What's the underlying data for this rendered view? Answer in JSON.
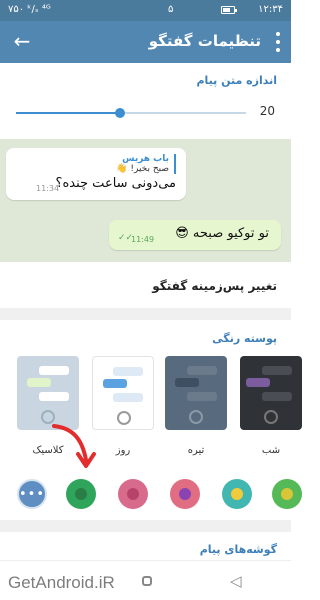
{
  "status_bar": {
    "time": "۱۲:۳۴",
    "left_text": "۷۵۰ ᵏ/ₛ ⁴ᴳ",
    "mid_text": "۵"
  },
  "app_bar": {
    "title": "تنظیمات گفتگو",
    "back_icon": "arrow-back-icon",
    "menu_icon": "more-vert-icon"
  },
  "text_size": {
    "label": "اندازه متن پیام",
    "value": "20",
    "level": 0.45
  },
  "preview": {
    "incoming": {
      "reply_name": "باب هریس",
      "reply_text": "صبح بخیر! 👋",
      "message": "می‌دونی ساعت چنده؟",
      "time": "11:34"
    },
    "outgoing": {
      "message": "تو توکیو صبحه 😎",
      "time": "11:49",
      "status_icon": "double-check-icon"
    },
    "background_color": "#dfe7d6"
  },
  "change_background": {
    "label": "تغییر پس‌زمینه گفتگو"
  },
  "color_theme": {
    "label": "پوسته رنگی",
    "themes": [
      {
        "name": "شب",
        "bg": "#2f3237",
        "in": "#4a4d53",
        "out": "#7b5c9e",
        "radio": "#777"
      },
      {
        "name": "تیره",
        "bg": "#586a7d",
        "in": "#6b7b8c",
        "out": "#3e4f61",
        "radio": "#8a99a8"
      },
      {
        "name": "روز",
        "bg": "#ffffff",
        "in": "#dde9f4",
        "out": "#5aa2e0",
        "radio": "#9a9a9a"
      },
      {
        "name": "کلاسیک",
        "bg": "#c9d6e1",
        "in": "#ffffff",
        "out": "#e1f3c8",
        "radio": "#9db0c0"
      }
    ]
  },
  "accent_colors": [
    {
      "name": "green-accent",
      "outer": "#2fa55c",
      "inner": "#2a7d47"
    },
    {
      "name": "pink-accent",
      "outer": "#d86b8b",
      "inner": "#b8436a"
    },
    {
      "name": "purple-accent",
      "outer": "#e16d82",
      "inner": "#8a43b2"
    },
    {
      "name": "teal-accent",
      "outer": "#42b7b1",
      "inner": "#f2cb3a"
    },
    {
      "name": "lime-accent",
      "outer": "#54b956",
      "inner": "#d8c538"
    }
  ],
  "chat_corners": {
    "label": "گوشه‌های پیام"
  },
  "watermark": "GetAndroid.iR"
}
